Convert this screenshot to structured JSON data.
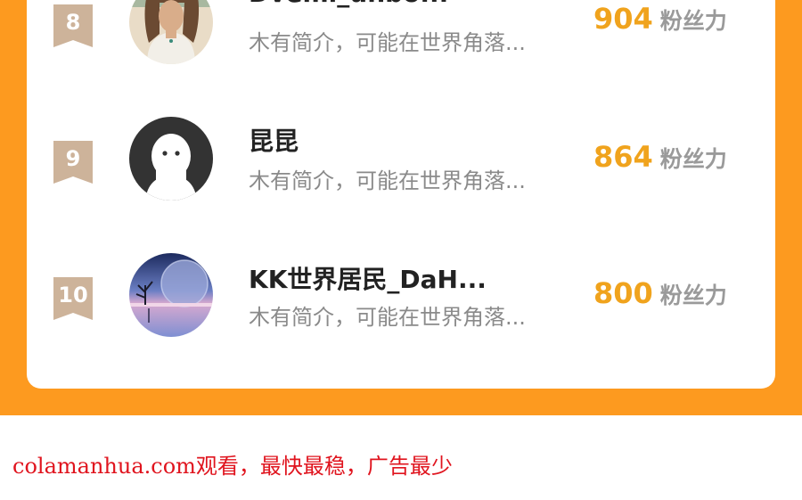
{
  "list": {
    "rows": [
      {
        "rank": "8",
        "name": "Dvemi_unbo...",
        "bio": "木有简介，可能在世界角落...",
        "fans": "904",
        "fans_label": "粉丝力"
      },
      {
        "rank": "9",
        "name": "昆昆",
        "bio": "木有简介，可能在世界角落...",
        "fans": "864",
        "fans_label": "粉丝力"
      },
      {
        "rank": "10",
        "name": "KK世界居民_DaH...",
        "bio": "木有简介，可能在世界角落...",
        "fans": "800",
        "fans_label": "粉丝力"
      }
    ]
  },
  "footer": {
    "text": "colamanhua.com观看，最快最稳，广告最少"
  },
  "colors": {
    "background": "#FD9A1F",
    "fans_number": "#F0A31D",
    "rank_badge": "#CDB39A",
    "footer_text": "#E0141E"
  }
}
